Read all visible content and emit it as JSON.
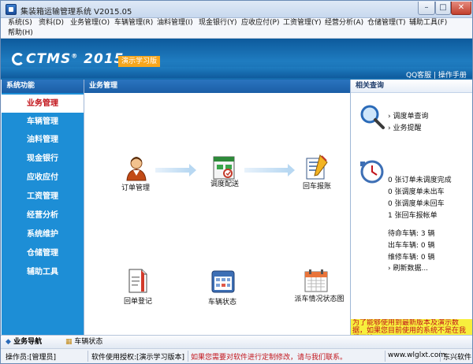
{
  "window": {
    "title": "集装箱运输管理系统 V2015.05",
    "minimize": "–",
    "maximize": "□",
    "close": "✕"
  },
  "menu": [
    "系统(S)",
    "资料(D)",
    "业务管理(O)",
    "车辆管理(R)",
    "油料管理(I)",
    "现金银行(Y)",
    "应收应付(P)",
    "工资管理(Y)",
    "经营分析(A)",
    "仓储管理(T)",
    "辅助工具(F)",
    "帮助(H)"
  ],
  "banner": {
    "logo": "CTMS",
    "logo_suffix": "®",
    "year": "2015",
    "demo_badge": "演示学习版",
    "links": "QQ客服 | 操作手册"
  },
  "sidebar": {
    "header": "系统功能",
    "items": [
      "业务管理",
      "车辆管理",
      "油料管理",
      "现金银行",
      "应收应付",
      "工资管理",
      "经营分析",
      "系统维护",
      "仓储管理",
      "辅助工具"
    ],
    "active_index": 0
  },
  "main": {
    "header": "业务管理",
    "workflow": [
      {
        "label": "订单管理",
        "icon": "operator-icon"
      },
      {
        "label": "调度配送",
        "icon": "dispatch-icon"
      },
      {
        "label": "回车报账",
        "icon": "return-report-icon"
      },
      {
        "label": "回单登记",
        "icon": "receipt-icon"
      },
      {
        "label": "车辆状态",
        "icon": "vehicle-status-icon"
      },
      {
        "label": "派车情况状态图",
        "icon": "calendar-icon"
      }
    ]
  },
  "right": {
    "header": "相关查询",
    "links": [
      "› 调度单查询",
      "› 业务提醒"
    ],
    "stats": [
      "0 张订单未调度完成",
      "0 张调度单未出车",
      "0 张调度单未回车",
      "1 张回车报帐单"
    ],
    "vehicles": [
      "待命车辆: 3 辆",
      "出车车辆: 0 辆",
      "维修车辆: 0 辆"
    ],
    "refresh": "› 刷新数据...",
    "notice": "为了能够使用到最新版本及演示数据，如果您目前使用的系统不是在我们网站"
  },
  "tabs": [
    "业务导航",
    "车辆状态"
  ],
  "status": {
    "operator": "操作员:[管理员]",
    "license": "软件使用授权:[演示学习版本]",
    "message": "如果您需要对软件进行定制修改，请与我们联系。",
    "website": "www.wlglxt.com",
    "company": "东兴软件"
  },
  "colors": {
    "banner": "#1f7cc0",
    "sidebar": "#1d8ed6",
    "active_text": "#c2141b",
    "badge": "#f6a61d",
    "notice": "#f7ef3d"
  }
}
